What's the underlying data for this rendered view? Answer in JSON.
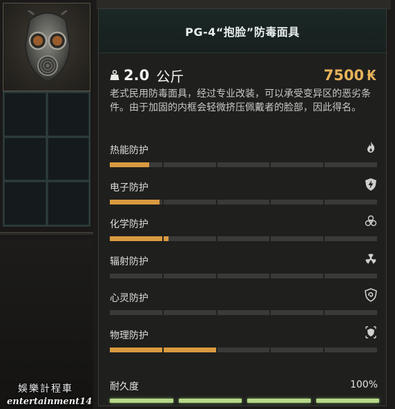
{
  "item": {
    "title": "PG-4“抱脸”防毒面具",
    "weight_value": "2.0",
    "weight_unit": "公斤",
    "price_value": "7500",
    "price_currency": "₭",
    "description": "老式民用防毒面具，经过专业改装，可以承受变异区的恶劣条件。由于加固的内框会轻微挤压佩戴者的脸部，因此得名。",
    "icon": "gas-mask-icon"
  },
  "stats": [
    {
      "label": "热能防护",
      "icon": "flame-icon",
      "level": 0.15
    },
    {
      "label": "电子防护",
      "icon": "lightning-shield-icon",
      "level": 0.19
    },
    {
      "label": "化学防护",
      "icon": "biohazard-icon",
      "level": 0.22
    },
    {
      "label": "辐射防护",
      "icon": "radiation-icon",
      "level": 0.0
    },
    {
      "label": "心灵防护",
      "icon": "psy-shield-icon",
      "level": 0.0
    },
    {
      "label": "物理防护",
      "icon": "armor-shield-icon",
      "level": 0.4
    }
  ],
  "durability": {
    "label": "耐久度",
    "value": "100%",
    "level": 1.0
  },
  "watermark": {
    "cn": "娛樂計程車",
    "en": "entertainment14"
  },
  "colors": {
    "accent": "#d99a3f",
    "price": "#e6b25a",
    "durability": "#b5d88a"
  }
}
